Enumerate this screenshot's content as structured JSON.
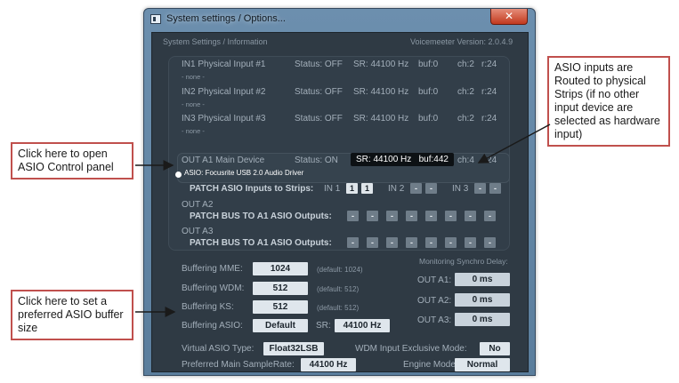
{
  "window": {
    "title": "System settings / Options...",
    "close_glyph": "✕"
  },
  "header": {
    "left": "System Settings / Information",
    "right": "Voicemeeter Version: 2.0.4.9"
  },
  "inputs": [
    {
      "name": "IN1 Physical Input #1",
      "device": "- none -",
      "status": "Status: OFF",
      "sr": "SR: 44100 Hz",
      "buf": "buf:0",
      "ch": "ch:2",
      "r": "r:24"
    },
    {
      "name": "IN2 Physical Input #2",
      "device": "- none -",
      "status": "Status: OFF",
      "sr": "SR: 44100 Hz",
      "buf": "buf:0",
      "ch": "ch:2",
      "r": "r:24"
    },
    {
      "name": "IN3 Physical Input #3",
      "device": "- none -",
      "status": "Status: OFF",
      "sr": "SR: 44100 Hz",
      "buf": "buf:0",
      "ch": "ch:2",
      "r": "r:24"
    }
  ],
  "out_a1": {
    "name": "OUT A1 Main Device",
    "status": "Status: ON",
    "sr": "SR: 44100 Hz",
    "buf": "buf:442",
    "ch": "ch:4",
    "r": "r:24",
    "driver": "ASIO: Focusrite USB 2.0 Audio Driver"
  },
  "patch_inputs": {
    "label": "PATCH ASIO Inputs to Strips:",
    "in1": "IN 1",
    "in2": "IN 2",
    "in3": "IN 3",
    "in1_buttons": [
      "1",
      "1"
    ],
    "in2_buttons": [
      "-",
      "-"
    ],
    "in3_buttons": [
      "-",
      "-"
    ]
  },
  "out_a2": {
    "name": "OUT A2",
    "patch_label": "PATCH BUS TO A1 ASIO Outputs:",
    "buttons": [
      "-",
      "-",
      "-",
      "-",
      "-",
      "-",
      "-",
      "-"
    ]
  },
  "out_a3": {
    "name": "OUT A3",
    "patch_label": "PATCH BUS TO A1 ASIO Outputs:",
    "buttons": [
      "-",
      "-",
      "-",
      "-",
      "-",
      "-",
      "-",
      "-"
    ]
  },
  "buffering": {
    "mme": {
      "label": "Buffering MME:",
      "value": "1024",
      "default": "(default: 1024)"
    },
    "wdm": {
      "label": "Buffering WDM:",
      "value": "512",
      "default": "(default: 512)"
    },
    "ks": {
      "label": "Buffering KS:",
      "value": "512",
      "default": "(default: 512)"
    },
    "asio": {
      "label": "Buffering ASIO:",
      "value": "Default",
      "sr_label": "SR:",
      "sr_value": "44100 Hz"
    }
  },
  "monitoring": {
    "title": "Monitoring Synchro Delay:",
    "a1": {
      "label": "OUT A1:",
      "value": "0 ms"
    },
    "a2": {
      "label": "OUT A2:",
      "value": "0 ms"
    },
    "a3": {
      "label": "OUT A3:",
      "value": "0 ms"
    }
  },
  "bottom": {
    "virtual_asio_label": "Virtual ASIO Type:",
    "virtual_asio_value": "Float32LSB",
    "wdm_exclusive_label": "WDM Input Exclusive Mode:",
    "wdm_exclusive_value": "No",
    "samplerate_label": "Preferred Main SampleRate:",
    "samplerate_value": "44100 Hz",
    "engine_label": "Engine Mode:",
    "engine_value": "Normal"
  },
  "callouts": {
    "asio_panel": "Click here to open ASIO Control panel",
    "asio_routing": "ASIO inputs are Routed to physical Strips (if no other input device are selected as hardware input)",
    "buffer_size": "Click here to set a preferred ASIO buffer size"
  },
  "colors": {
    "callout_border": "#c0504d",
    "panel_bg": "#2f3a44",
    "window_frame": "#6c8fae"
  }
}
